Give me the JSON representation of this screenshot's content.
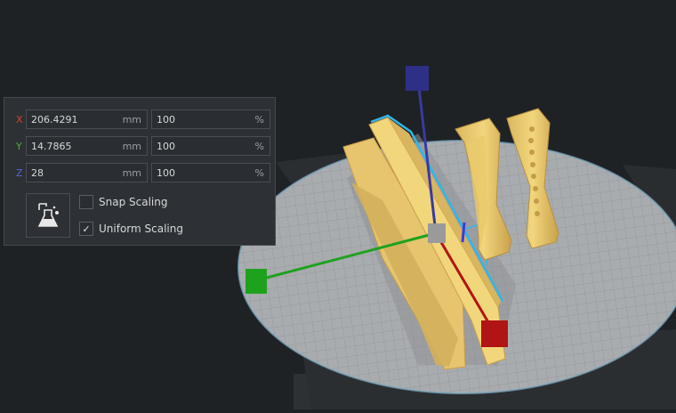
{
  "scale_panel": {
    "rows": [
      {
        "axis": "X",
        "axis_color": "#d8432f",
        "value_mm": "206.4291",
        "unit_mm": "mm",
        "value_pct": "100",
        "unit_pct": "%"
      },
      {
        "axis": "Y",
        "axis_color": "#4caf3c",
        "value_mm": "14.7865",
        "unit_mm": "mm",
        "value_pct": "100",
        "unit_pct": "%"
      },
      {
        "axis": "Z",
        "axis_color": "#5468d4",
        "value_mm": "28",
        "unit_mm": "mm",
        "value_pct": "100",
        "unit_pct": "%"
      }
    ],
    "snap_scaling": {
      "label": "Snap Scaling",
      "checked": false
    },
    "uniform_scaling": {
      "label": "Uniform Scaling",
      "checked": true,
      "check_mark": "✓"
    },
    "tool_icon": "scale-tool-icon"
  },
  "colors": {
    "background": "#1f2225",
    "build_plate": "#a9acaf",
    "model": "#f2d67c",
    "selection_outline": "#31b7e6",
    "handle_x": "#b01414",
    "handle_y": "#1ea21e",
    "handle_z": "#30308a"
  }
}
